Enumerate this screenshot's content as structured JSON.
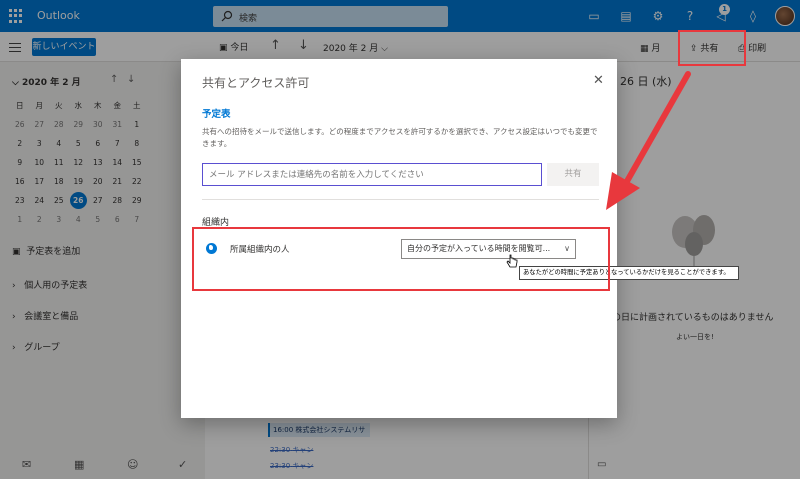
{
  "app": {
    "name": "Outlook"
  },
  "topbar": {
    "search_placeholder": "検索",
    "notification_count": "1"
  },
  "cmdbar": {
    "new_event": "新しいイベント",
    "today": "今日",
    "month": "2020 年 2 月",
    "view": "月",
    "share": "共有",
    "print": "印刷"
  },
  "mini_calendar": {
    "title": "2020 年 2 月",
    "weekdays": [
      "日",
      "月",
      "火",
      "水",
      "木",
      "金",
      "土"
    ],
    "weeks": [
      [
        "26",
        "27",
        "28",
        "29",
        "30",
        "31",
        "1"
      ],
      [
        "2",
        "3",
        "4",
        "5",
        "6",
        "7",
        "8"
      ],
      [
        "9",
        "10",
        "11",
        "12",
        "13",
        "14",
        "15"
      ],
      [
        "16",
        "17",
        "18",
        "19",
        "20",
        "21",
        "22"
      ],
      [
        "23",
        "24",
        "25",
        "26",
        "27",
        "28",
        "29"
      ],
      [
        "1",
        "2",
        "3",
        "4",
        "5",
        "6",
        "7"
      ]
    ],
    "selected": "26"
  },
  "leftpane": {
    "add_calendar": "予定表を追加",
    "groups": [
      "個人用の予定表",
      "会議室と備品",
      "グループ"
    ]
  },
  "main": {
    "day_header": "26 日 (水)",
    "empty_message": "の日に計画されているものはありません",
    "empty_sub": "よい一日を!",
    "events": [
      {
        "time": "16:00",
        "title": "株式会社システムリサ"
      },
      {
        "time": "22:30",
        "title": "キャン"
      },
      {
        "time": "23:30",
        "title": "キャン"
      }
    ]
  },
  "dialog": {
    "title": "共有とアクセス許可",
    "section": "予定表",
    "description": "共有への招待をメールで送信します。どの程度までアクセスを許可するかを選択でき、アクセス設定はいつでも変更できます。",
    "email_placeholder": "メール アドレスまたは連絡先の名前を入力してください",
    "share_button": "共有",
    "org_heading": "組織内",
    "org_member": "所属組織内の人",
    "permission": "自分の予定が入っている時間を閲覧可...",
    "tooltip": "あなたがどの時間に予定ありとなっているかだけを見ることができます。"
  },
  "colors": {
    "accent": "#0078d4",
    "annotation": "#e8383d"
  }
}
